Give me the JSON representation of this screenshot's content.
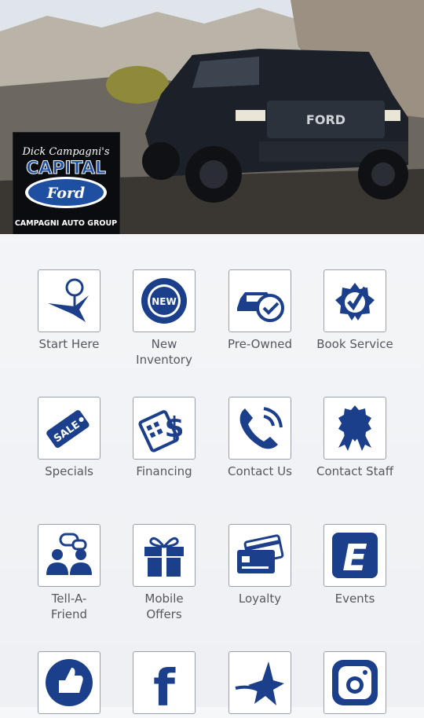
{
  "hero": {
    "brand_script": "Dick Campagni's",
    "brand_name": "CAPITAL",
    "brand_oval": "Ford",
    "brand_group": "CAMPAGNI AUTO GROUP",
    "truck_grille": "FORD"
  },
  "tiles": [
    {
      "label": "Start Here",
      "icon": "pin-star-icon"
    },
    {
      "label": "New\nInventory",
      "icon": "new-badge-icon"
    },
    {
      "label": "Pre-Owned",
      "icon": "car-check-icon"
    },
    {
      "label": "Book Service",
      "icon": "seal-check-icon"
    },
    {
      "label": "Specials",
      "icon": "sale-tag-icon",
      "badge": "SALE"
    },
    {
      "label": "Financing",
      "icon": "calculator-dollar-icon"
    },
    {
      "label": "Contact Us",
      "icon": "phone-icon"
    },
    {
      "label": "Contact Staff",
      "icon": "award-ribbon-icon"
    },
    {
      "label": "Tell-A-\nFriend",
      "icon": "people-chat-icon"
    },
    {
      "label": "Mobile\nOffers",
      "icon": "gift-icon"
    },
    {
      "label": "Loyalty",
      "icon": "credit-cards-icon"
    },
    {
      "label": "Events",
      "icon": "events-e-icon",
      "badge": "E"
    },
    {
      "label": "",
      "icon": "thumbs-up-icon"
    },
    {
      "label": "",
      "icon": "facebook-icon",
      "badge": "f"
    },
    {
      "label": "",
      "icon": "star-swoosh-icon"
    },
    {
      "label": "",
      "icon": "instagram-icon"
    }
  ],
  "colors": {
    "icon_blue": "#1c3f8c",
    "label_gray": "#55585e"
  }
}
